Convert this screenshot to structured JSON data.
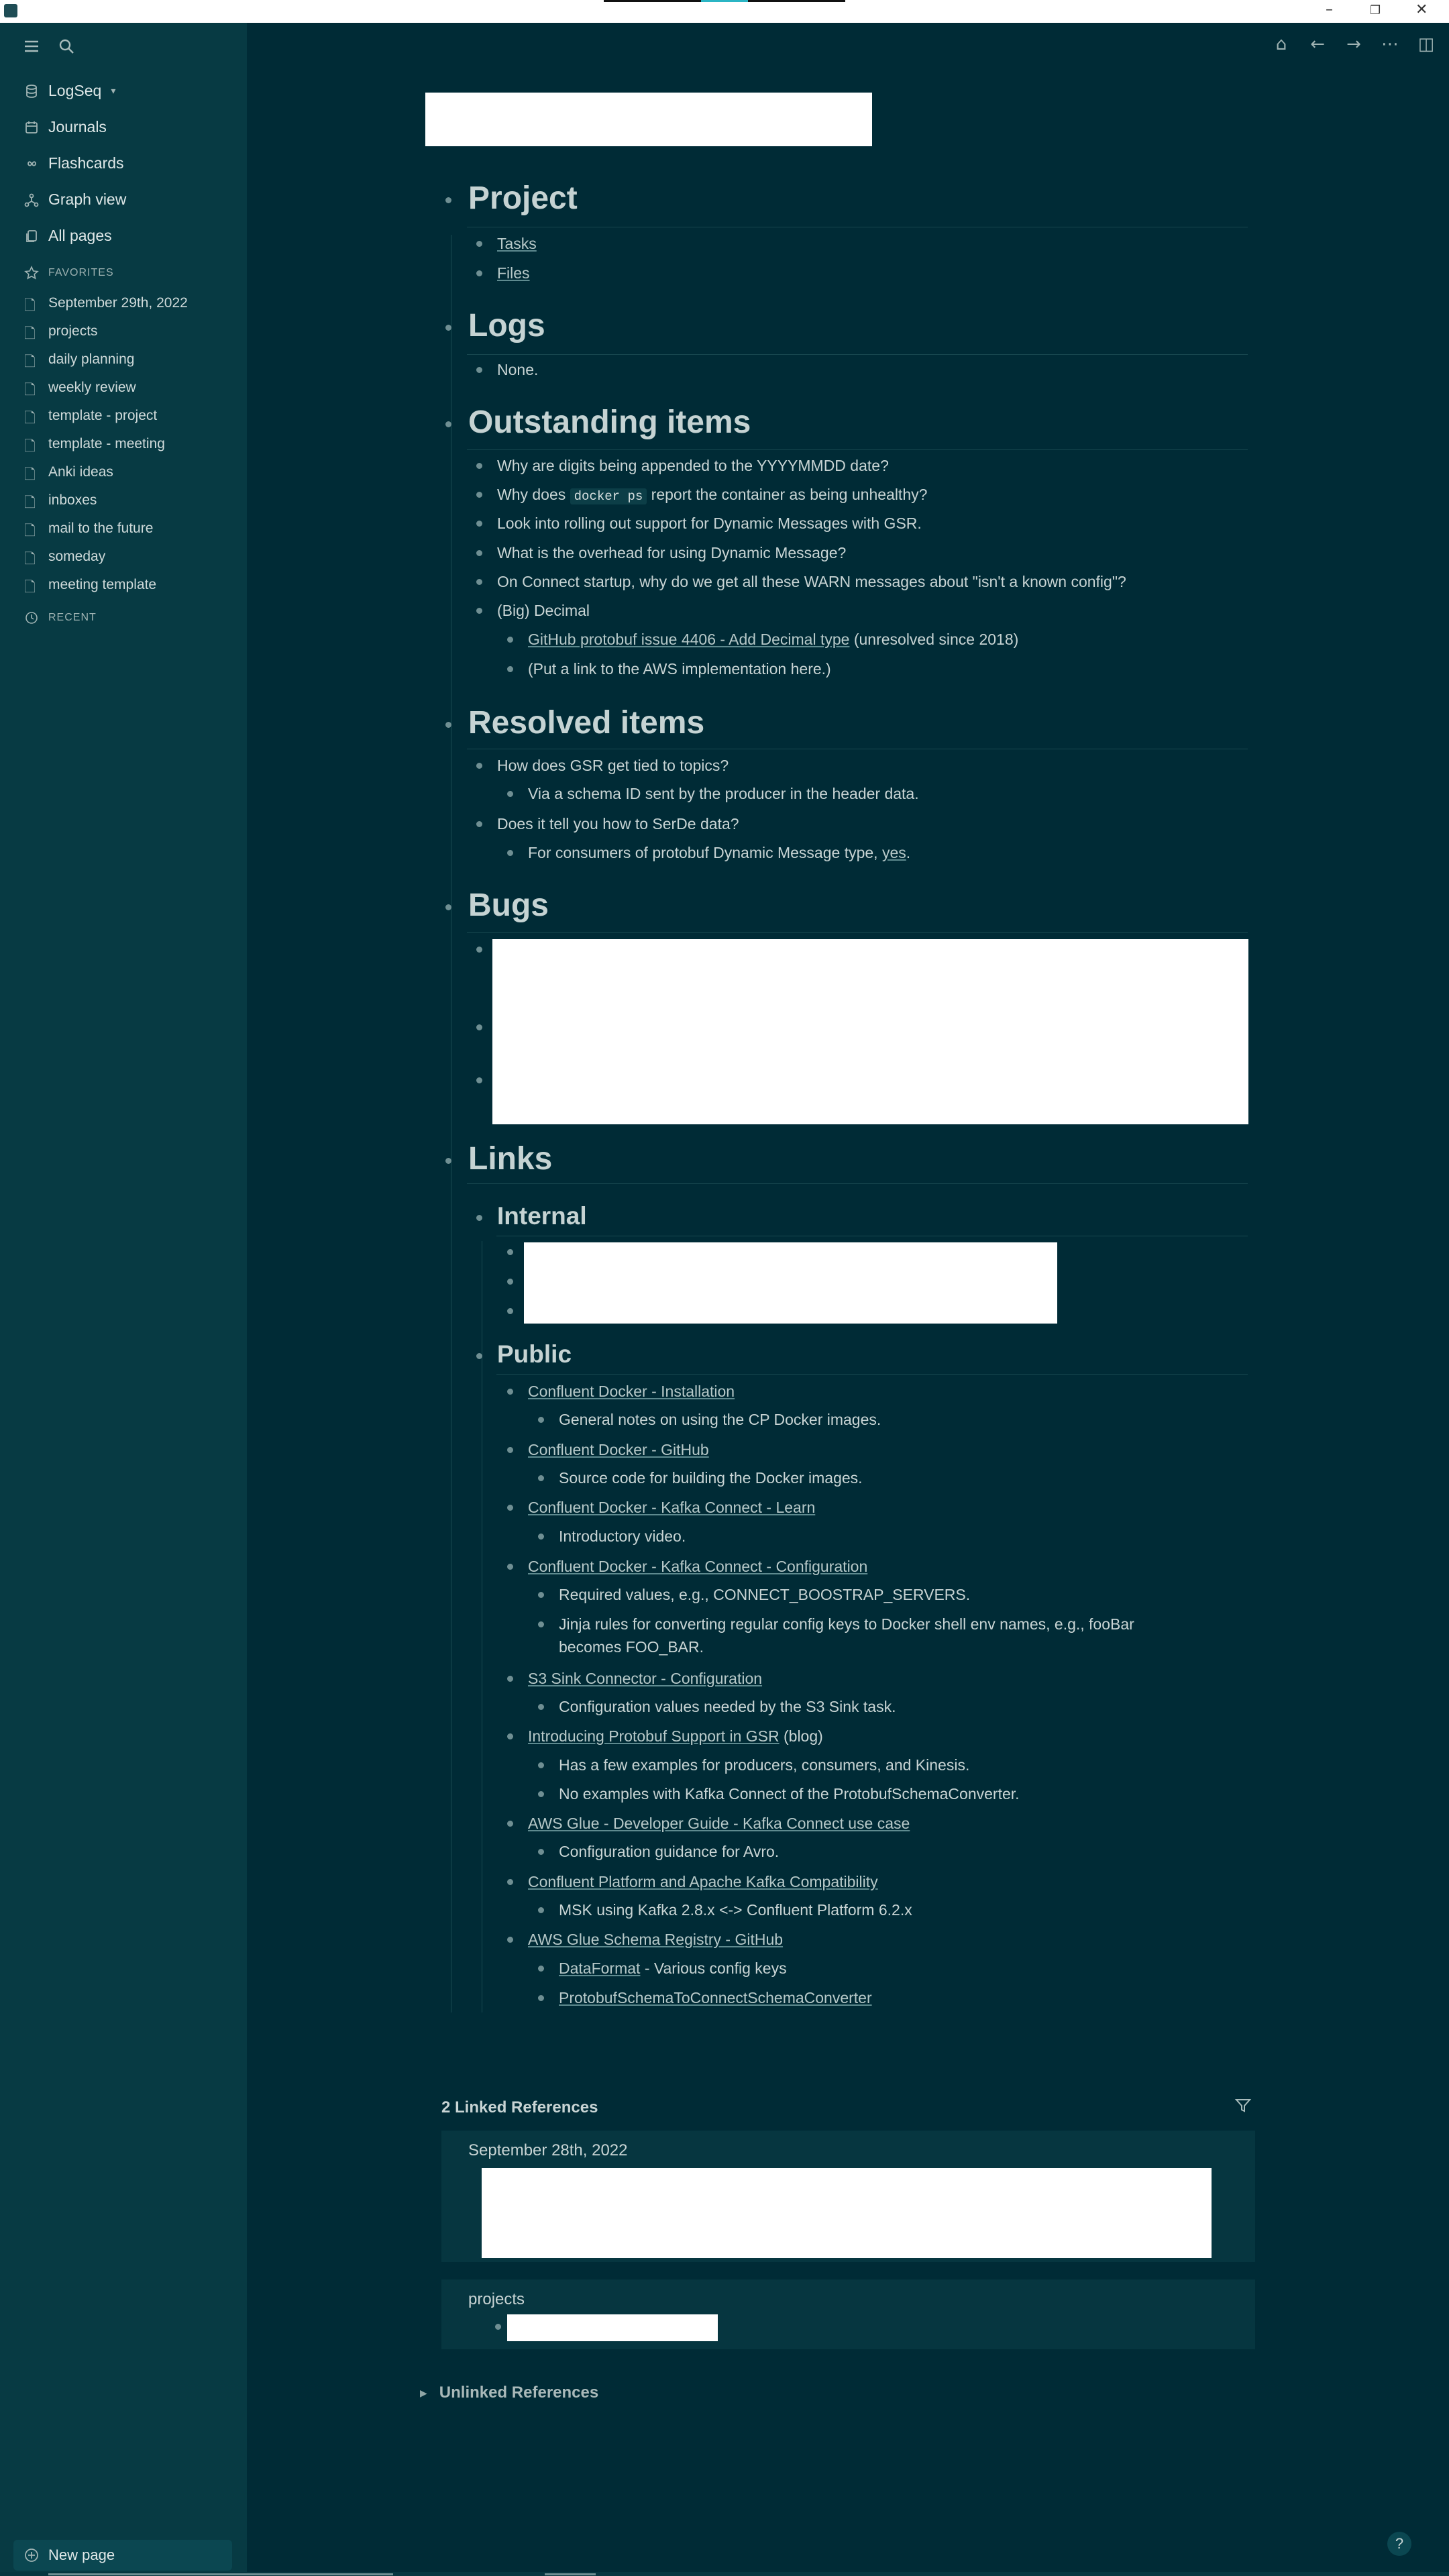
{
  "sidebar": {
    "graph_name": "LogSeq",
    "nav": [
      "Journals",
      "Flashcards",
      "Graph view",
      "All pages"
    ],
    "favorites_label": "FAVORITES",
    "favorites": [
      "September 29th, 2022",
      "projects",
      "daily planning",
      "weekly review",
      "template - project",
      "template - meeting",
      "Anki ideas",
      "inboxes",
      "mail to the future",
      "someday",
      "meeting template"
    ],
    "recent_label": "RECENT",
    "new_page": "New page"
  },
  "page": {
    "project": {
      "heading": "Project",
      "items": [
        "Tasks",
        "Files"
      ]
    },
    "logs": {
      "heading": "Logs",
      "items": [
        "None."
      ]
    },
    "outstanding": {
      "heading": "Outstanding items",
      "q1": "Why are digits being appended to the YYYYMMDD date?",
      "q2_pre": "Why does",
      "q2_code": "docker ps",
      "q2_post": "report the container as being unhealthy?",
      "q3": "Look into rolling out support for Dynamic Messages with GSR.",
      "q4": "What is the overhead for using Dynamic Message?",
      "q5": "On Connect startup, why do we get all these WARN messages about \"isn't a known config\"?",
      "q6": "(Big) Decimal",
      "q6a_link": "GitHub protobuf issue 4406 - Add Decimal type",
      "q6a_post": "(unresolved since 2018)",
      "q6b": "(Put a link to the AWS implementation here.)"
    },
    "resolved": {
      "heading": "Resolved items",
      "r1": "How does GSR get tied to topics?",
      "r1a": "Via a schema ID sent by the producer in the header data.",
      "r2": "Does it tell you how to SerDe data?",
      "r2a_pre": "For consumers of protobuf Dynamic Message type,",
      "r2a_link": "yes",
      "r2a_post": "."
    },
    "bugs": {
      "heading": "Bugs"
    },
    "links": {
      "heading": "Links",
      "internal": "Internal",
      "public": "Public",
      "l1": "Confluent Docker - Installation",
      "l1a": "General notes on using the CP Docker images.",
      "l2": "Confluent Docker - GitHub",
      "l2a": "Source code for building the Docker images.",
      "l3": "Confluent Docker - Kafka Connect - Learn",
      "l3a": "Introductory video.",
      "l4": "Confluent Docker - Kafka Connect - Configuration",
      "l4a": "Required values, e.g., CONNECT_BOOSTRAP_SERVERS.",
      "l4b_1": "Jinja rules for converting regular config keys to Docker shell env names, e.g., fooBar",
      "l4b_2": "becomes FOO_BAR.",
      "l5": "S3 Sink Connector - Configuration",
      "l5a": "Configuration values needed by the S3 Sink task.",
      "l6": "Introducing Protobuf Support in GSR",
      "l6_post": "(blog)",
      "l6a": "Has a few examples for producers, consumers, and Kinesis.",
      "l6b": "No examples with Kafka Connect of the ProtobufSchemaConverter.",
      "l7": "AWS Glue - Developer Guide - Kafka Connect use case",
      "l7a": "Configuration guidance for Avro.",
      "l8": "Confluent Platform and Apache Kafka Compatibility",
      "l8a": "MSK using Kafka 2.8.x <-> Confluent Platform 6.2.x",
      "l9": "AWS Glue Schema Registry - GitHub",
      "l9a_link": "DataFormat",
      "l9a_post": "- Various config keys",
      "l9b": "ProtobufSchemaToConnectSchemaConverter"
    }
  },
  "references": {
    "linked_title": "2 Linked References",
    "ref1_title": "September 28th, 2022",
    "ref2_title": "projects",
    "unlinked_title": "Unlinked References"
  }
}
